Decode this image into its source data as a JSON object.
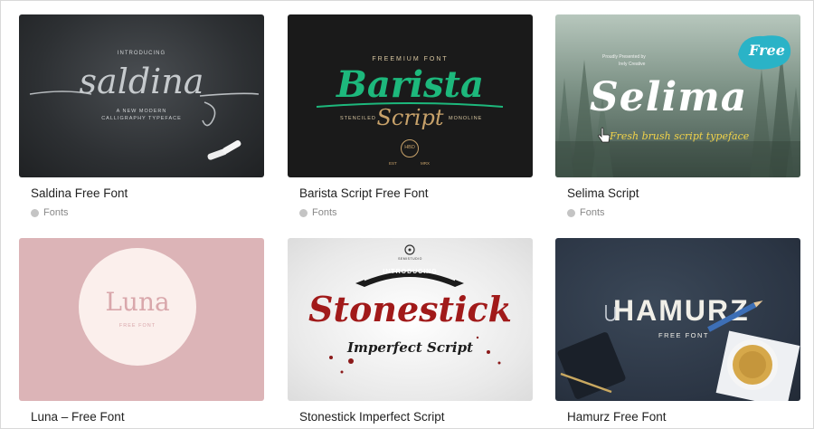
{
  "cards": [
    {
      "title": "Saldina Free Font",
      "category": "Fonts",
      "thumb": {
        "intro": "INTRODUCING",
        "word": "saldina",
        "sub1": "A NEW MODERN",
        "sub2": "CALLIGRAPHY TYPEFACE"
      }
    },
    {
      "title": "Barista Script Free Font",
      "category": "Fonts",
      "thumb": {
        "top": "FREEMIUM FONT",
        "word": "Barista",
        "left": "STENCILED",
        "word2": "Script",
        "right": "MONOLINE",
        "badge": "HBD",
        "badge_left": "EST",
        "badge_right": "MRX"
      }
    },
    {
      "title": "Selima Script",
      "category": "Fonts",
      "thumb": {
        "free": "Free",
        "small": "Proudly Presented by",
        "brand": "Irely Creative",
        "word": "Selima",
        "sub": "Fresh brush script typeface"
      }
    },
    {
      "title": "Luna – Free Font",
      "category": "Fonts",
      "thumb": {
        "word": "Luna",
        "sub": "FREE FONT"
      }
    },
    {
      "title": "Stonestick Imperfect Script",
      "category": "Fonts",
      "thumb": {
        "brand": "SEMISTUDIO",
        "banner": "INTRODUCING",
        "word": "Stonestick",
        "sub": "Imperfect Script"
      }
    },
    {
      "title": "Hamurz Free Font",
      "category": "Fonts",
      "thumb": {
        "word": "HAMURZ",
        "sub": "FREE FONT"
      }
    }
  ]
}
